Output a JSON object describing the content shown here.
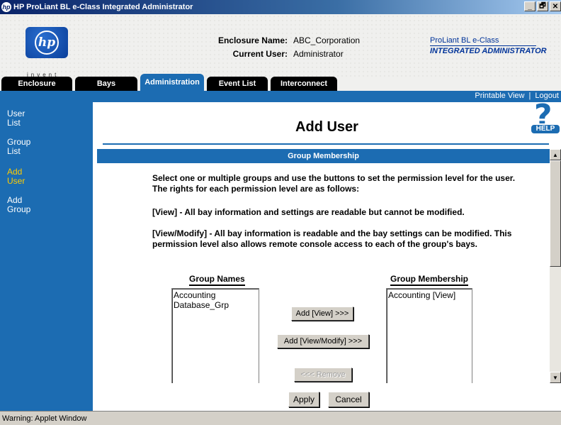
{
  "window": {
    "title": "HP ProLiant BL e-Class Integrated Administrator",
    "logo_letter": "hp",
    "buttons": [
      "_",
      "🗗",
      "✕"
    ]
  },
  "header": {
    "invent": "invent",
    "logo_text": "hp",
    "enclosure_label": "Enclosure Name:",
    "enclosure_value": "ABC_Corporation",
    "user_label": "Current User:",
    "user_value": "Administrator",
    "brand_line1": "ProLiant BL e-Class",
    "brand_line2": "INTEGRATED ADMINISTRATOR"
  },
  "tabs": [
    {
      "label": "Enclosure",
      "active": false
    },
    {
      "label": "Bays",
      "active": false
    },
    {
      "label": "Administration",
      "active": true
    },
    {
      "label": "Event List",
      "active": false
    },
    {
      "label": "Interconnect",
      "active": false
    }
  ],
  "toplinks": {
    "printable": "Printable View",
    "sep": "|",
    "logout": "Logout"
  },
  "sidebar": {
    "items": [
      {
        "line1": "User",
        "line2": "List",
        "active": false
      },
      {
        "line1": "Group",
        "line2": "List",
        "active": false
      },
      {
        "line1": "Add",
        "line2": "User",
        "active": true
      },
      {
        "line1": "Add",
        "line2": "Group",
        "active": false
      }
    ]
  },
  "main": {
    "title": "Add User",
    "help_label": "HELP",
    "help_q": "?",
    "section_header": "Group Membership",
    "intro": "Select one or multiple groups and use the buttons to set the permission level for the user. The rights for each permission level are as follows:",
    "view_desc": "[View] - All bay information and settings are readable but cannot be modified.",
    "viewmodify_desc": "[View/Modify] - All bay information is readable and the bay settings can be modified. This permission level also allows remote console access to each of the group's bays.",
    "group_names_header": "Group Names",
    "group_membership_header": "Group Membership",
    "group_names": [
      "Accounting",
      "Database_Grp"
    ],
    "membership": [
      "Accounting [View]"
    ],
    "add_view_btn": "Add [View] >>>",
    "add_viewmodify_btn": "Add [View/Modify] >>>",
    "remove_btn": "<<< Remove",
    "apply_btn": "Apply",
    "cancel_btn": "Cancel"
  },
  "status": {
    "text": "Warning: Applet Window"
  },
  "colors": {
    "accent": "#1c6cb2",
    "active_nav": "#ffcc00",
    "brand": "#003399"
  }
}
